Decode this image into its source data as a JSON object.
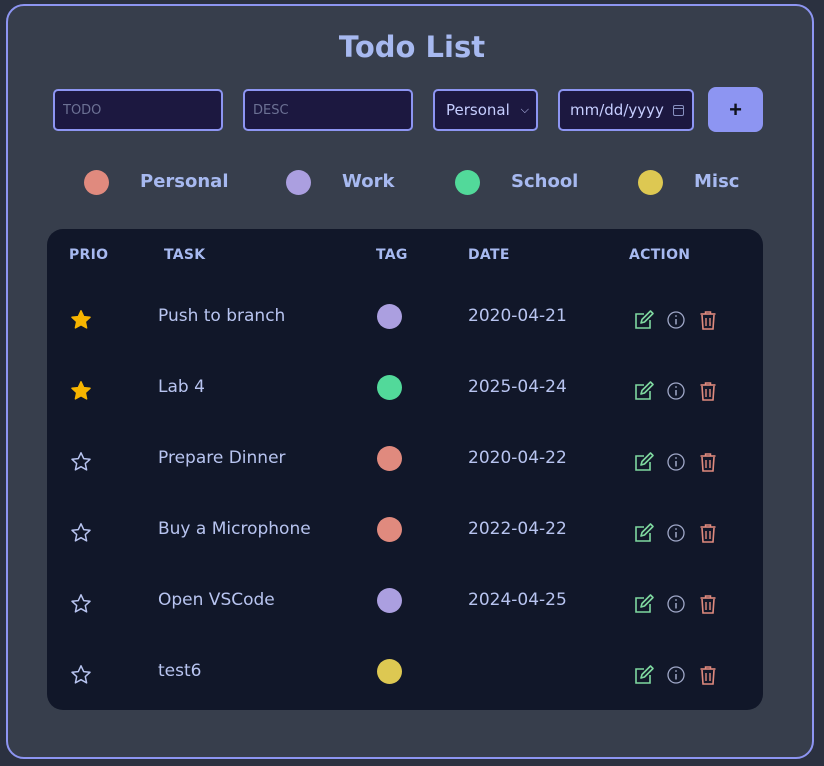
{
  "title": "Todo List",
  "form": {
    "todo_placeholder": "TODO",
    "desc_placeholder": "DESC",
    "tag_value": "Personal",
    "date_placeholder": "mm/dd/yyyy",
    "add_label": "+"
  },
  "legend": [
    {
      "label": "Personal",
      "color": "#e08a7e"
    },
    {
      "label": "Work",
      "color": "#ab9fe0"
    },
    {
      "label": "School",
      "color": "#52d99a"
    },
    {
      "label": "Misc",
      "color": "#ddc852"
    }
  ],
  "table": {
    "headers": [
      "PRIO",
      "TASK",
      "TAG",
      "DATE",
      "ACTION"
    ],
    "rows": [
      {
        "starred": true,
        "task": "Push to branch",
        "tag": "Work",
        "date": "2020-04-21"
      },
      {
        "starred": true,
        "task": "Lab 4",
        "tag": "School",
        "date": "2025-04-24"
      },
      {
        "starred": false,
        "task": "Prepare Dinner",
        "tag": "Personal",
        "date": "2020-04-22"
      },
      {
        "starred": false,
        "task": "Buy a Microphone",
        "tag": "Personal",
        "date": "2022-04-22"
      },
      {
        "starred": false,
        "task": "Open VSCode",
        "tag": "Work",
        "date": "2024-04-25"
      },
      {
        "starred": false,
        "task": "test6",
        "tag": "Misc",
        "date": ""
      }
    ]
  },
  "colors": {
    "accent": "#8d95f2",
    "star_filled": "#f7b500",
    "star_outline": "#b8c4f0",
    "edit_icon": "#7fd8a0",
    "info_icon": "#a0a8c8",
    "delete_icon": "#e08a7e"
  }
}
